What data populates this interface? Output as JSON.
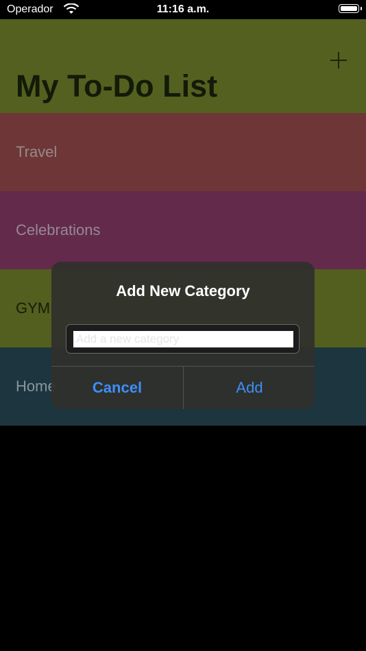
{
  "status_bar": {
    "carrier": "Operador",
    "time": "11:16 a.m."
  },
  "nav": {
    "title": "My To-Do List",
    "add_icon": "plus-icon"
  },
  "categories": [
    {
      "name": "Travel",
      "color": "#7b3d3d"
    },
    {
      "name": "Celebrations",
      "color": "#6f2f55"
    },
    {
      "name": "GYM",
      "color": "#5d6a23"
    },
    {
      "name": "Home",
      "color": "#203c46"
    }
  ],
  "alert": {
    "title": "Add New Category",
    "input_placeholder": "Add a new category",
    "input_value": "",
    "cancel_label": "Cancel",
    "add_label": "Add"
  },
  "colors": {
    "accent": "#3e8ff7",
    "nav_background": "#5e6b23"
  }
}
